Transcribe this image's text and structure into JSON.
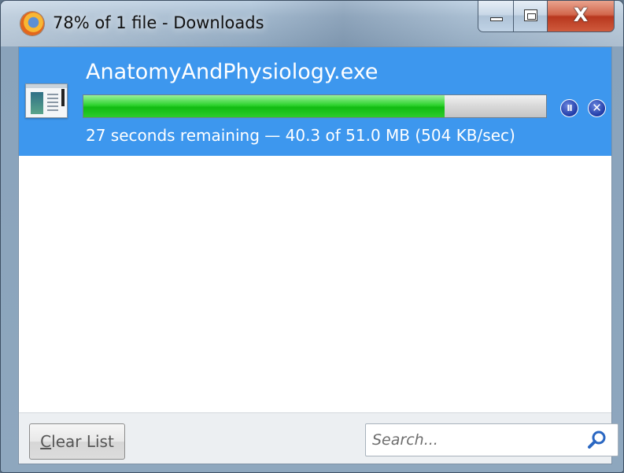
{
  "window": {
    "title": "78% of 1 file - Downloads",
    "app_icon": "firefox-logo-icon",
    "caption_buttons": [
      "minimize",
      "maximize",
      "close"
    ],
    "close_glyph": "X"
  },
  "download": {
    "file_name": "AnatomyAndPhysiology.exe",
    "file_icon": "executable-file-icon",
    "progress_percent": 78,
    "status": "27 seconds remaining — 40.3 of 51.0 MB (504 KB/sec)",
    "pause_glyph": "II",
    "cancel_glyph": "✕",
    "selected_background": "#3d97ee",
    "progress_color": "#1fc61f"
  },
  "footer": {
    "clear_mnemonic": "C",
    "clear_rest": "lear List",
    "search_placeholder": "Search...",
    "search_value": ""
  }
}
